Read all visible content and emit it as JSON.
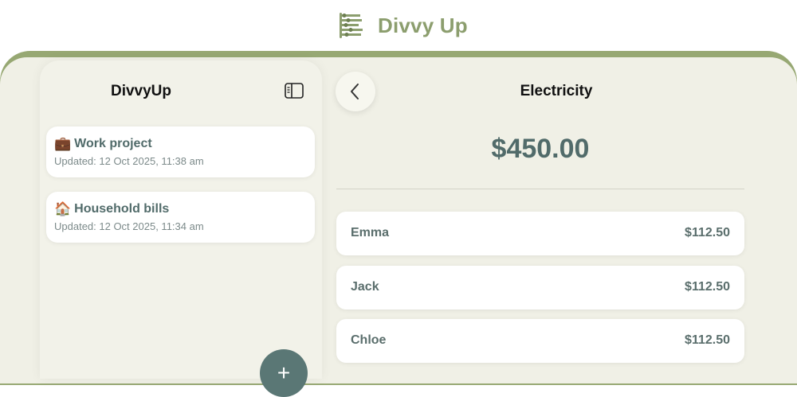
{
  "app": {
    "name": "Divvy Up"
  },
  "sidebar": {
    "title": "DivvyUp",
    "groups": [
      {
        "emoji": "💼",
        "title": "Work project",
        "updated": "Updated: 12 Oct 2025, 11:38 am"
      },
      {
        "emoji": "🏠",
        "title": "Household bills",
        "updated": "Updated: 12 Oct 2025, 11:34 am"
      }
    ],
    "fab_label": "+"
  },
  "detail": {
    "title": "Electricity",
    "amount": "$450.00",
    "shares": [
      {
        "name": "Emma",
        "amount": "$112.50"
      },
      {
        "name": "Jack",
        "amount": "$112.50"
      },
      {
        "name": "Chloe",
        "amount": "$112.50"
      }
    ]
  },
  "colors": {
    "brand": "#8c9e6e",
    "frame": "#97a873",
    "surface": "#f0f0e6",
    "accent_text": "#516b6a"
  },
  "icons": {
    "logo": "abacus-logo-icon",
    "sidebar_toggle": "sidebar-toggle-icon",
    "back": "chevron-left-icon",
    "fab": "plus-icon"
  }
}
